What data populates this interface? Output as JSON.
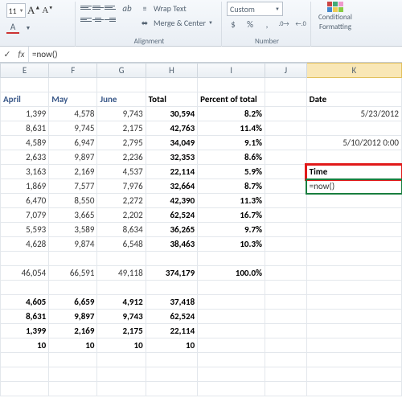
{
  "ribbon": {
    "font_size": "11",
    "wrap_text": "Wrap Text",
    "merge_center": "Merge & Center",
    "group_alignment": "Alignment",
    "number_format": "Custom",
    "group_number": "Number",
    "cond_fmt_line1": "Conditional",
    "cond_fmt_line2": "Formatting"
  },
  "formula_bar": {
    "fx": "fx",
    "value": "=now()"
  },
  "columns": {
    "E": "E",
    "F": "F",
    "G": "G",
    "H": "H",
    "I": "I",
    "J": "J",
    "K": "K"
  },
  "headers": {
    "april": "April",
    "may": "May",
    "june": "June",
    "total": "Total",
    "pct": "Percent of total",
    "date": "Date",
    "time": "Time"
  },
  "rows": [
    {
      "e": "1,399",
      "f": "4,578",
      "g": "9,743",
      "h": "30,594",
      "i": "8.2%"
    },
    {
      "e": "8,631",
      "f": "9,745",
      "g": "2,175",
      "h": "42,763",
      "i": "11.4%"
    },
    {
      "e": "4,589",
      "f": "6,947",
      "g": "2,795",
      "h": "34,049",
      "i": "9.1%"
    },
    {
      "e": "2,633",
      "f": "9,897",
      "g": "2,236",
      "h": "32,353",
      "i": "8.6%"
    },
    {
      "e": "3,163",
      "f": "2,169",
      "g": "4,537",
      "h": "22,114",
      "i": "5.9%"
    },
    {
      "e": "1,869",
      "f": "7,577",
      "g": "7,976",
      "h": "32,664",
      "i": "8.7%"
    },
    {
      "e": "6,470",
      "f": "8,550",
      "g": "2,272",
      "h": "42,390",
      "i": "11.3%"
    },
    {
      "e": "7,079",
      "f": "3,665",
      "g": "2,202",
      "h": "62,524",
      "i": "16.7%"
    },
    {
      "e": "5,593",
      "f": "3,589",
      "g": "8,634",
      "h": "36,265",
      "i": "9.7%"
    },
    {
      "e": "4,628",
      "f": "9,874",
      "g": "6,548",
      "h": "38,463",
      "i": "10.3%"
    }
  ],
  "totals": {
    "e": "46,054",
    "f": "66,591",
    "g": "49,118",
    "h": "374,179",
    "i": "100.0%"
  },
  "summary": [
    {
      "e": "4,605",
      "f": "6,659",
      "g": "4,912",
      "h": "37,418"
    },
    {
      "e": "8,631",
      "f": "9,897",
      "g": "9,743",
      "h": "62,524"
    },
    {
      "e": "1,399",
      "f": "2,169",
      "g": "2,175",
      "h": "22,114"
    },
    {
      "e": "10",
      "f": "10",
      "g": "10",
      "h": "10"
    }
  ],
  "k_vals": {
    "date1": "5/23/2012",
    "date2": "5/10/2012 0:00",
    "formula": "=now()"
  }
}
